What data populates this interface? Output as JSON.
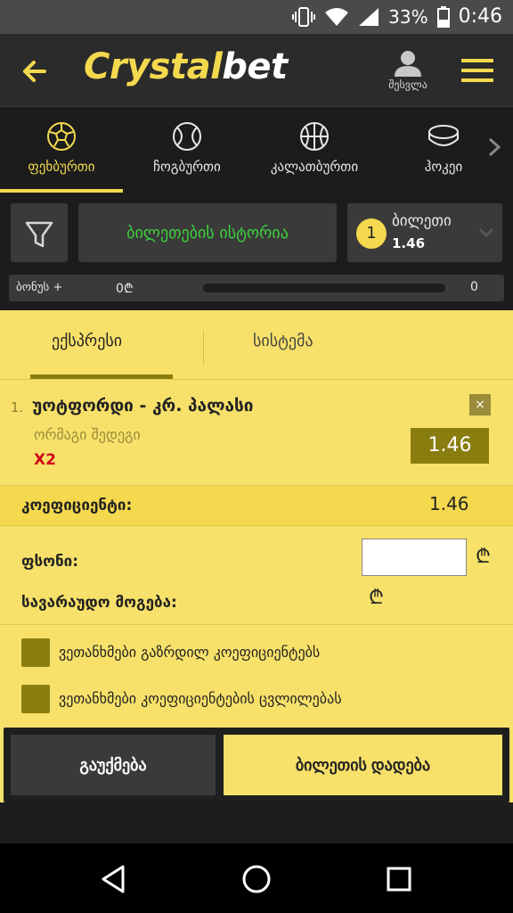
{
  "status": {
    "battery": "33%",
    "time": "0:46"
  },
  "header": {
    "logo_main": "Crystal",
    "logo_suffix": "bet",
    "user_label": "შესვლა"
  },
  "sports": [
    {
      "label": "ფეხბურთი",
      "icon": "soccer-ball-icon",
      "active": true
    },
    {
      "label": "ჩოგბურთი",
      "icon": "tennis-ball-icon",
      "active": false
    },
    {
      "label": "კალათბურთი",
      "icon": "basketball-icon",
      "active": false
    },
    {
      "label": "ჰოკეი",
      "icon": "hockey-puck-icon",
      "active": false
    }
  ],
  "toolbar": {
    "history_label": "ბილეთების ისტორია",
    "ticket_count": "1",
    "ticket_label": "ბილეთი",
    "ticket_odd": "1.46"
  },
  "bonus": {
    "label": "ბონუს +",
    "amount": "0₾",
    "count": "0"
  },
  "slip": {
    "tabs": [
      "ექსპრესი",
      "სისტემა"
    ],
    "bet": {
      "index": "1.",
      "match": "უოტფორდი - კრ. პალასი",
      "market": "ორმაგი შედეგი",
      "selection": "X2",
      "odd": "1.46",
      "close": "×"
    },
    "coef_label": "კოეფიციენტი:",
    "coef_value": "1.46",
    "stake_label": "ფსონი:",
    "stake_value": "",
    "currency": "₾",
    "win_label": "სავარაუდო მოგება:",
    "checks": [
      "ვეთანხმები გაზრდილ კოეფიციენტებს",
      "ვეთანხმები კოეფიციენტების ცვლილებას"
    ],
    "cancel_label": "გაუქმება",
    "place_label": "ბილეთის დადება"
  },
  "colors": {
    "accent": "#f4d94e",
    "slip_bg": "#f8e16a",
    "green": "#3cd33c",
    "olive": "#8a7d10"
  }
}
